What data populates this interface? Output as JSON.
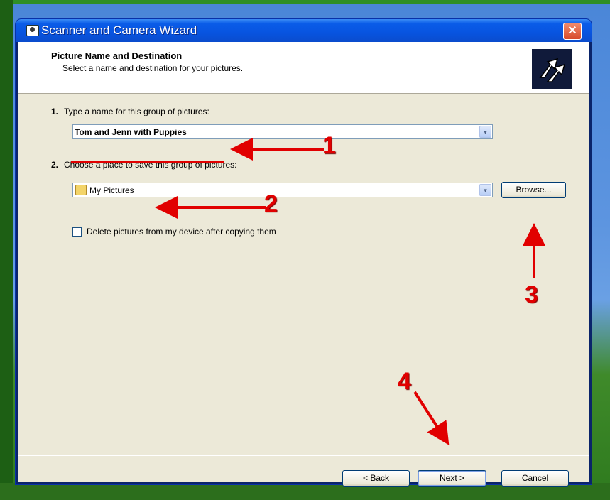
{
  "window": {
    "title": "Scanner and Camera Wizard",
    "close": "✕"
  },
  "header": {
    "title": "Picture Name and Destination",
    "subtitle": "Select a name and destination for your pictures."
  },
  "step1": {
    "number": "1.",
    "label": "Type a name for this group of pictures:",
    "value": "Tom and Jenn with Puppies"
  },
  "step2": {
    "number": "2.",
    "label": "Choose a place to save this group of pictures:",
    "value": "My Pictures",
    "browse": "Browse..."
  },
  "checkbox": {
    "label": "Delete pictures from my device after copying them",
    "checked": false
  },
  "buttons": {
    "back": "< Back",
    "next": "Next >",
    "cancel": "Cancel"
  },
  "annotations": {
    "a1": "1",
    "a2": "2",
    "a3": "3",
    "a4": "4",
    "color": "#e10000"
  },
  "icons": {
    "dropdown": "▾",
    "title_icon": "camera-icon",
    "folder_icon": "folder-icon",
    "logo": "wizard-logo-icon"
  }
}
